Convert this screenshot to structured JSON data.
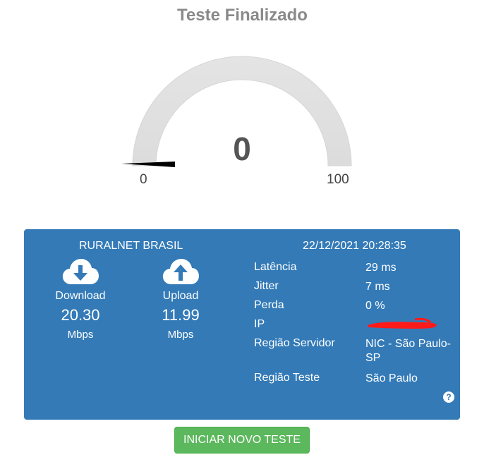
{
  "page": {
    "title": "Teste Finalizado"
  },
  "gauge": {
    "value": "0",
    "min_label": "0",
    "max_label": "100",
    "level": 0
  },
  "result": {
    "provider": "RURALNET BRASIL",
    "datetime": "22/12/2021 20:28:35",
    "download": {
      "label": "Download",
      "value": "20.30",
      "unit": "Mbps"
    },
    "upload": {
      "label": "Upload",
      "value": "11.99",
      "unit": "Mbps"
    },
    "stats": [
      {
        "label": "Latência",
        "value": "29 ms"
      },
      {
        "label": "Jitter",
        "value": "7 ms"
      },
      {
        "label": "Perda",
        "value": "0 %"
      },
      {
        "label": "IP",
        "value": ""
      },
      {
        "label": "Região Servidor",
        "value": "NIC - São Paulo-SP"
      },
      {
        "label": "Região Teste",
        "value": "São Paulo"
      }
    ],
    "help_glyph": "?"
  },
  "actions": {
    "restart_label": "INICIAR NOVO TESTE"
  },
  "colors": {
    "panel": "#337ab7",
    "button": "#5cb85c",
    "redaction": "#ff0000"
  },
  "icons": [
    "cloud-download-icon",
    "cloud-upload-icon",
    "help-icon"
  ]
}
